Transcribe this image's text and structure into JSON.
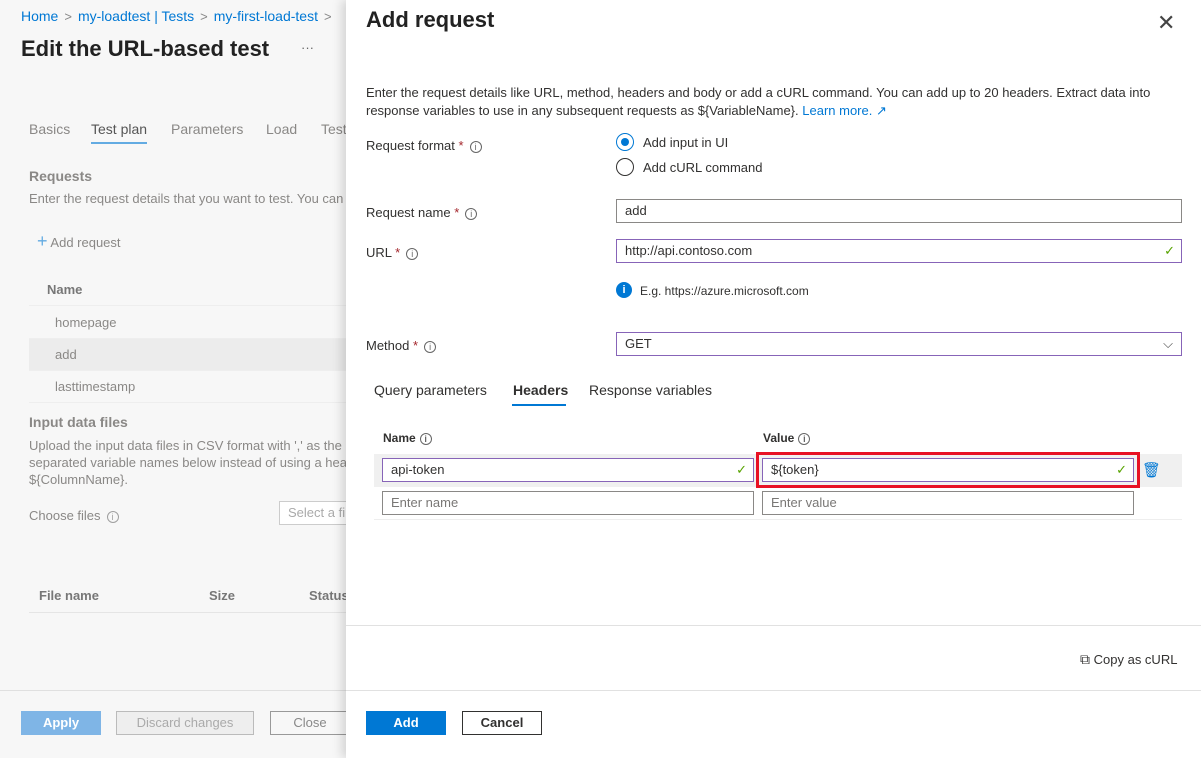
{
  "breadcrumb": [
    "Home",
    "my-loadtest | Tests",
    "my-first-load-test"
  ],
  "page_title": "Edit the URL-based test",
  "more": "···",
  "tabs": [
    "Basics",
    "Test plan",
    "Parameters",
    "Load",
    "Test"
  ],
  "requests": {
    "title": "Requests",
    "desc": "Enter the request details that you want to test. You can",
    "add": "Add request",
    "col": "Name",
    "rows": [
      "homepage",
      "add",
      "lasttimestamp"
    ]
  },
  "input_files": {
    "title": "Input data files",
    "desc1": "Upload the input data files in CSV format with ',' as the",
    "desc2": "separated variable names below instead of using a head",
    "desc3": "${ColumnName}.",
    "choose": "Choose files",
    "select_ph": "Select a fil",
    "cols": [
      "File name",
      "Size",
      "Status"
    ]
  },
  "footer": {
    "apply": "Apply",
    "discard": "Discard changes",
    "close": "Close"
  },
  "panel": {
    "title": "Add request",
    "desc1": "Enter the request details like URL, method, headers and body or add a cURL command. You can add up to 20 headers. Extract data into",
    "desc2": "response variables to use in any subsequent requests as ${VariableName}.",
    "learn_more": "Learn more.",
    "format_label": "Request format",
    "format_options": [
      "Add input in UI",
      "Add cURL command"
    ],
    "format_selected": "Add input in UI",
    "name_label": "Request name",
    "name_value": "add",
    "url_label": "URL",
    "url_value": "http://api.contoso.com",
    "url_hint": "E.g. https://azure.microsoft.com",
    "method_label": "Method",
    "method_value": "GET",
    "tabs": [
      "Query parameters",
      "Headers",
      "Response variables"
    ],
    "active_tab": "Headers",
    "headers": {
      "name_col": "Name",
      "value_col": "Value",
      "rows": [
        {
          "name": "api-token",
          "value": "${token}"
        }
      ],
      "name_ph": "Enter name",
      "value_ph": "Enter value"
    },
    "copy_curl": "Copy as cURL",
    "add": "Add",
    "cancel": "Cancel"
  },
  "colors": {
    "accent": "#0078d4",
    "highlight": "#e81123",
    "valid": "#57a300",
    "focus": "#8764b8"
  }
}
